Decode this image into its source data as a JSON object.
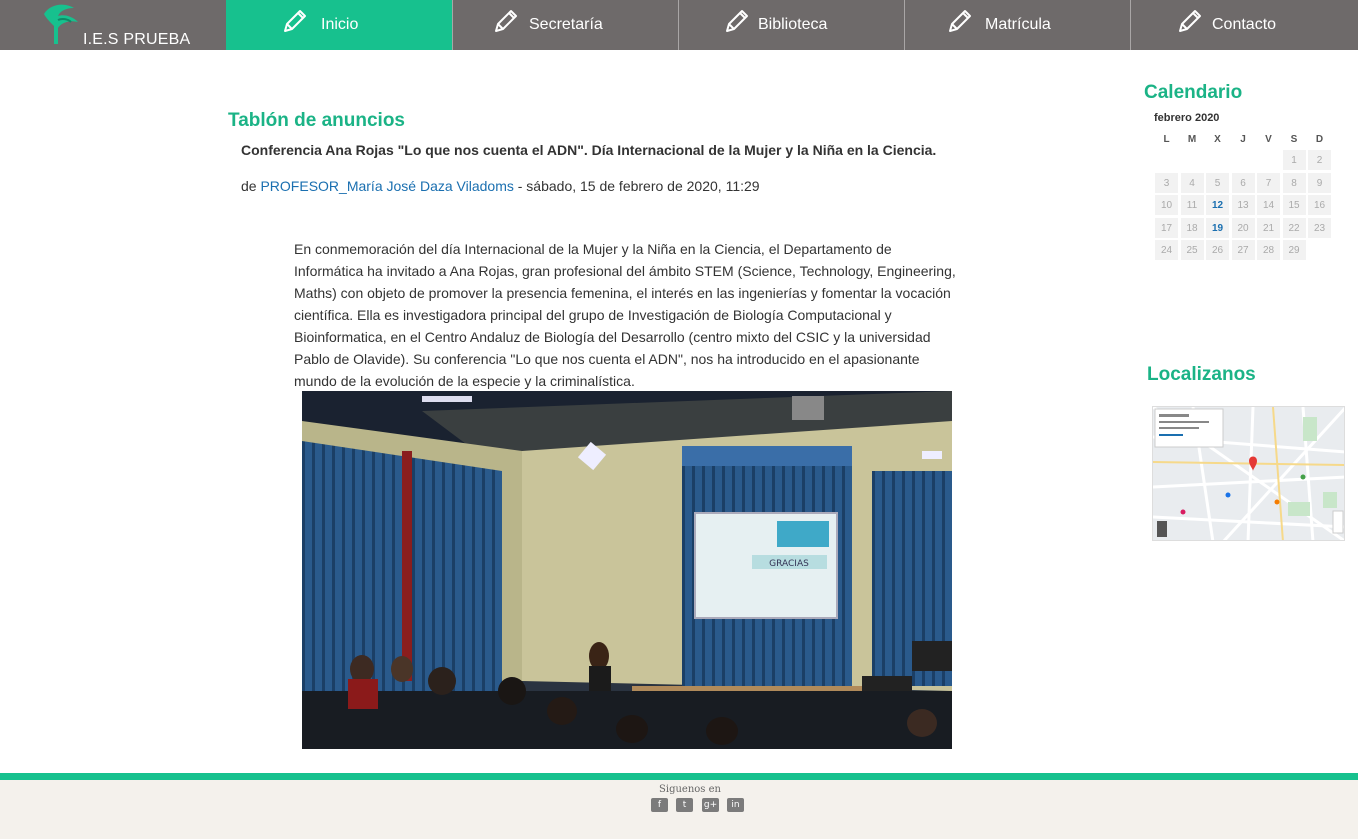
{
  "site": {
    "logo_text": "I.E.S PRUEBA"
  },
  "nav": {
    "items": [
      {
        "label": "Inicio",
        "active": true
      },
      {
        "label": "Secretaría",
        "active": false
      },
      {
        "label": "Biblioteca",
        "active": false
      },
      {
        "label": "Matrícula",
        "active": false
      },
      {
        "label": "Contacto",
        "active": false
      }
    ]
  },
  "colors": {
    "accent": "#17c18e",
    "nav_bg": "#6e6a6a",
    "link": "#1a6fb0"
  },
  "main": {
    "section_title": "Tablón de anuncios",
    "post": {
      "title": "Conferencia Ana Rojas \"Lo que nos cuenta el ADN\". Día Internacional de la Mujer y la Niña en la Ciencia.",
      "by_prefix": "de ",
      "author": "PROFESOR_María José Daza Viladoms",
      "date": " - sábado, 15 de febrero de 2020, 11:29",
      "body": "En conmemoración del día Internacional de la Mujer y la Niña en la Ciencia, el Departamento de Informática ha invitado a Ana Rojas, gran profesional del ámbito STEM (Science, Technology, Engineering, Maths) con objeto de promover la presencia femenina, el interés en las ingenierías y fomentar la vocación científica. Ella es investigadora principal del grupo de Investigación de Biología Computacional y Bioinformatica, en el Centro Andaluz de Biología del Desarrollo (centro mixto del CSIC y la universidad Pablo de Olavide).  Su conferencia  \"Lo  que nos cuenta el ADN\", nos ha introducido en el apasionante mundo de la evolución de la especie y la criminalística.",
      "slide_text": "GRACIAS"
    }
  },
  "sidebar": {
    "calendar_title": "Calendario",
    "month": "febrero 2020",
    "weekdays": [
      "L",
      "M",
      "X",
      "J",
      "V",
      "S",
      "D"
    ],
    "weeks": [
      [
        "",
        "",
        "",
        "",
        "",
        "1",
        "2"
      ],
      [
        "3",
        "4",
        "5",
        "6",
        "7",
        "8",
        "9"
      ],
      [
        "10",
        "11",
        "12",
        "13",
        "14",
        "15",
        "16"
      ],
      [
        "17",
        "18",
        "19",
        "20",
        "21",
        "22",
        "23"
      ],
      [
        "24",
        "25",
        "26",
        "27",
        "28",
        "29",
        ""
      ]
    ],
    "linked_days": [
      "12",
      "19"
    ],
    "map_title": "Localizanos"
  },
  "footer": {
    "follow_label": "Siguenos en",
    "social": [
      "f",
      "t",
      "g+",
      "in"
    ]
  }
}
